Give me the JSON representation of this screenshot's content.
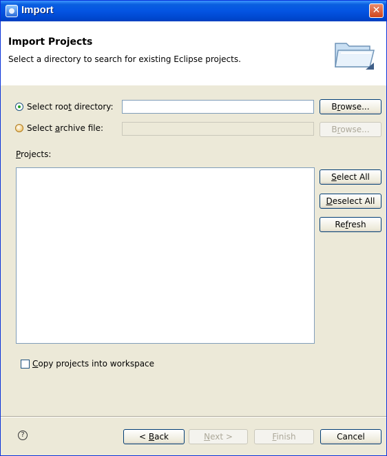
{
  "window": {
    "title": "Import"
  },
  "banner": {
    "title": "Import Projects",
    "description": "Select a directory to search for existing Eclipse projects."
  },
  "root_dir": {
    "label_pre": "Select roo",
    "label_ul": "t",
    "label_post": " directory:",
    "value": "",
    "checked": true
  },
  "archive": {
    "label_pre": "Select ",
    "label_ul": "a",
    "label_post": "rchive file:",
    "value": "",
    "checked": false
  },
  "browse_root": {
    "pre": "B",
    "ul": "r",
    "post": "owse..."
  },
  "browse_archive": {
    "pre": "B",
    "ul": "r",
    "post": "owse..."
  },
  "projects": {
    "label_ul": "P",
    "label_post": "rojects:",
    "items": []
  },
  "select_all": {
    "ul": "S",
    "post": "elect All"
  },
  "deselect_all": {
    "ul": "D",
    "post": "eselect All"
  },
  "refresh": {
    "pre": "Re",
    "ul": "f",
    "post": "resh"
  },
  "copy_projects": {
    "ul": "C",
    "post": "opy projects into workspace",
    "checked": false
  },
  "footer": {
    "back": {
      "pre": "< ",
      "ul": "B",
      "post": "ack"
    },
    "next": {
      "ul": "N",
      "post": "ext >"
    },
    "finish": {
      "ul": "F",
      "post": "inish"
    },
    "cancel": "Cancel"
  }
}
